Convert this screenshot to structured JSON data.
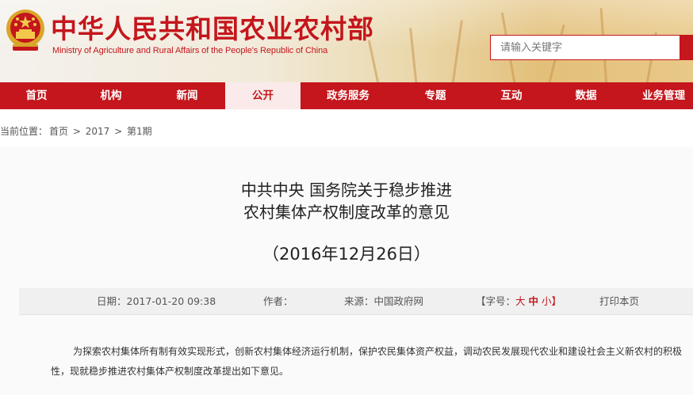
{
  "header": {
    "title_cn": "中华人民共和国农业农村部",
    "title_en": "Ministry of Agriculture and Rural Affairs of the People's Republic of China",
    "search_placeholder": "请输入关键字",
    "emblem_icon": "national-emblem-icon"
  },
  "nav": {
    "items": [
      "首页",
      "机构",
      "新闻",
      "公开",
      "政务服务",
      "专题",
      "互动",
      "数据",
      "业务管理"
    ],
    "active": "公开"
  },
  "breadcrumb": {
    "label": "当前位置：",
    "items": [
      "首页",
      "2017",
      "第1期"
    ],
    "separator": ">"
  },
  "article": {
    "title_line1": "中共中央  国务院关于稳步推进",
    "title_line2": "农村集体产权制度改革的意见",
    "date_line": "（2016年12月26日）",
    "meta": {
      "date_label": "日期：",
      "date_value": "2017-01-20 09:38",
      "author_label": "作者：",
      "source_label": "来源：",
      "source_value": "中国政府网",
      "font_label": "【字号：",
      "font_large": "大",
      "font_medium": "中",
      "font_small": "小】",
      "print_label": "打印本页"
    },
    "paragraph": "为探索农村集体所有制有效实现形式，创新农村集体经济运行机制，保护农民集体资产权益，调动农民发展现代农业和建设社会主义新农村的积极性，现就稳步推进农村集体产权制度改革提出如下意见。"
  },
  "colors": {
    "brand_red": "#c4161c",
    "active_tab_bg": "#fbeaea"
  }
}
